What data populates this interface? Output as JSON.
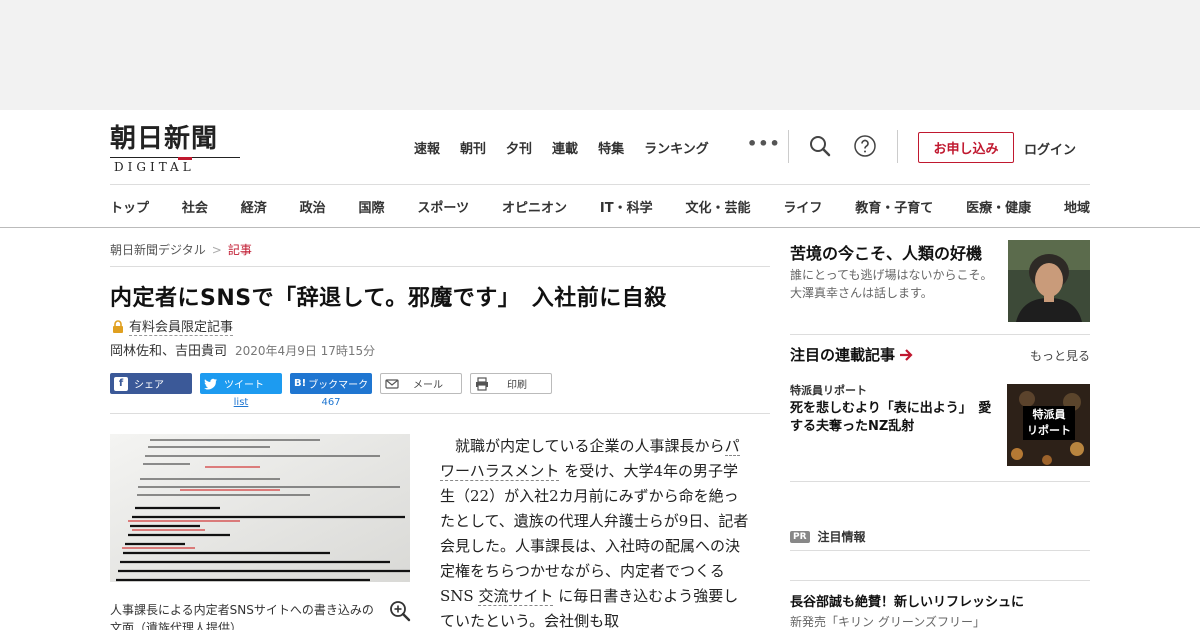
{
  "logo": {
    "main": "朝日新聞",
    "sub": "DIGITAL"
  },
  "topnav": [
    "速報",
    "朝刊",
    "夕刊",
    "連載",
    "特集",
    "ランキング"
  ],
  "more_dots": "•••",
  "header_actions": {
    "apply": "お申し込み",
    "login": "ログイン",
    "search_icon": "search-icon",
    "help_icon": "help-icon"
  },
  "catnav": [
    "トップ",
    "社会",
    "経済",
    "政治",
    "国際",
    "スポーツ",
    "オピニオン",
    "IT・科学",
    "文化・芸能",
    "ライフ",
    "教育・子育て",
    "医療・健康",
    "地域"
  ],
  "breadcrumb": {
    "home": "朝日新聞デジタル",
    "sep": ">",
    "current": "記事"
  },
  "article": {
    "title": "内定者にSNSで「辞退して。邪魔です」　入社前に自殺",
    "paid_label": "有料会員限定記事",
    "authors": "岡林佐和、吉田貴司",
    "date": "2020年4月9日 17時15分",
    "share": {
      "facebook": "シェア",
      "twitter": "ツイート",
      "twitter_count": "list",
      "hatena": "ブックマーク",
      "hatena_badge": "B!",
      "hatena_count": "467",
      "mail": "メール",
      "print": "印刷"
    },
    "photo_caption": "人事課長による内定者SNSサイトへの書き込みの文面（遺族代理人提供）",
    "body": {
      "p1_a": "就職が内定している企業の人事課長から",
      "link1": "パワーハラスメント",
      "p1_b": "を受け、大学4年の男子学生（22）が入社2カ月前にみずから命を絶ったとして、遺族の代理人弁護士らが9日、記者会見した。人事課長は、入社時の配属への決定権をちらつかせながら、内定者でつくるSNS",
      "link2": "交流サイト",
      "p1_c": "に毎日書き込むよう強要していたという。会社側も取"
    }
  },
  "sidebar": {
    "feature": {
      "title": "苦境の今こそ、人類の好機",
      "desc": "誰にとっても逃げ場はないからこそ。大澤真幸さんは話します。"
    },
    "series": {
      "section_title": "注目の連載記事",
      "more": "もっと見る",
      "kicker": "特派員リポート",
      "title": "死を悲しむより「表に出よう」　愛する夫奪ったNZ乱射",
      "img_text_1": "特派員",
      "img_text_2": "リポート"
    },
    "pr": {
      "badge": "PR",
      "label": "注目情報"
    },
    "promo": {
      "title": "長谷部誠も絶賛！新しいリフレッシュに",
      "sub": "新発売「キリン グリーンズフリー」"
    }
  },
  "colors": {
    "accent": "#c0182f",
    "facebook": "#3b5998",
    "twitter": "#1d9bf0",
    "hatena": "#1f76d1"
  }
}
